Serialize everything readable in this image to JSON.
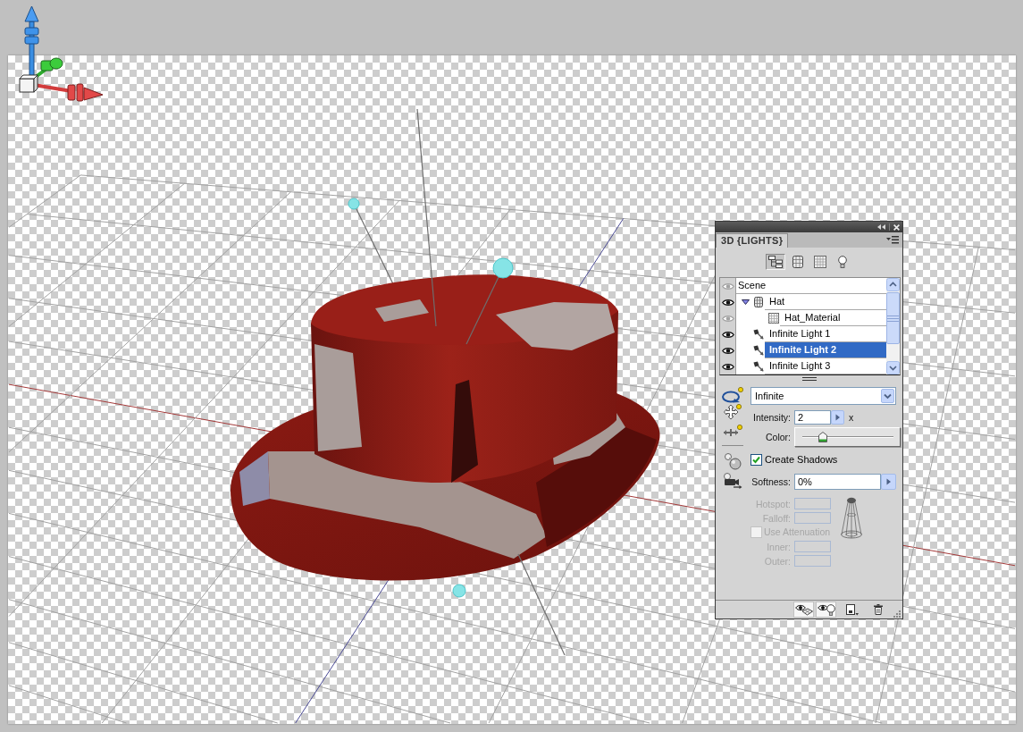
{
  "panel": {
    "tab": {
      "label": "3D {LIGHTS}",
      "selected": true
    },
    "filters": [
      {
        "kind": "scene",
        "selected": true
      },
      {
        "kind": "meshes",
        "selected": false
      },
      {
        "kind": "materials",
        "selected": false
      },
      {
        "kind": "lights",
        "selected": false
      }
    ],
    "tree": [
      {
        "label": "Scene",
        "eye_active": false,
        "selected": false,
        "children": [
          {
            "label": "Hat",
            "kind": "mesh",
            "eye_active": true,
            "selected": false,
            "expanded": true,
            "children": [
              {
                "label": "Hat_Material",
                "kind": "material",
                "eye_active": false,
                "selected": false
              }
            ]
          },
          {
            "label": "Infinite Light 1",
            "kind": "light",
            "eye_active": true,
            "selected": false
          },
          {
            "label": "Infinite Light 2",
            "kind": "light",
            "eye_active": true,
            "selected": true
          },
          {
            "label": "Infinite Light 3",
            "kind": "light",
            "eye_active": true,
            "selected": false
          }
        ]
      }
    ],
    "light_type": {
      "value": "Infinite"
    },
    "intensity": {
      "label": "Intensity:",
      "value": "2",
      "unit": "x",
      "level": 0.2
    },
    "color": {
      "label": "Color:"
    },
    "create_shadows": {
      "label": "Create Shadows",
      "checked": true
    },
    "softness": {
      "label": "Softness:",
      "value": "0%"
    },
    "spot_settings": [
      {
        "kind": "field",
        "label": "Hotspot:",
        "disabled": true
      },
      {
        "kind": "field",
        "label": "Falloff:",
        "disabled": true
      },
      {
        "kind": "checkbox",
        "label": "Use Attenuation",
        "checked": false,
        "disabled": true
      },
      {
        "kind": "field",
        "label": "Inner:",
        "disabled": true
      },
      {
        "kind": "field",
        "label": "Outer:",
        "disabled": true
      }
    ],
    "bottom_toggles": [
      {
        "kind": "mesh_visibility",
        "on": true
      },
      {
        "kind": "light_visibility",
        "on": true
      }
    ],
    "bottom_buttons": [
      {
        "kind": "new_light"
      },
      {
        "kind": "delete"
      }
    ]
  }
}
